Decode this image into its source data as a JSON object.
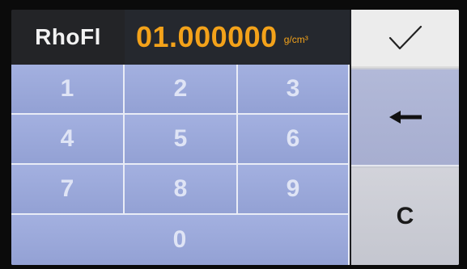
{
  "display": {
    "label": "RhoFl",
    "value": "01.000000",
    "unit": "g/cm³"
  },
  "keypad": {
    "keys": [
      "1",
      "2",
      "3",
      "4",
      "5",
      "6",
      "7",
      "8",
      "9",
      "0"
    ]
  },
  "actions": {
    "ok_icon": "checkmark-icon",
    "back_icon": "arrow-left-icon",
    "clear_label": "C"
  }
}
